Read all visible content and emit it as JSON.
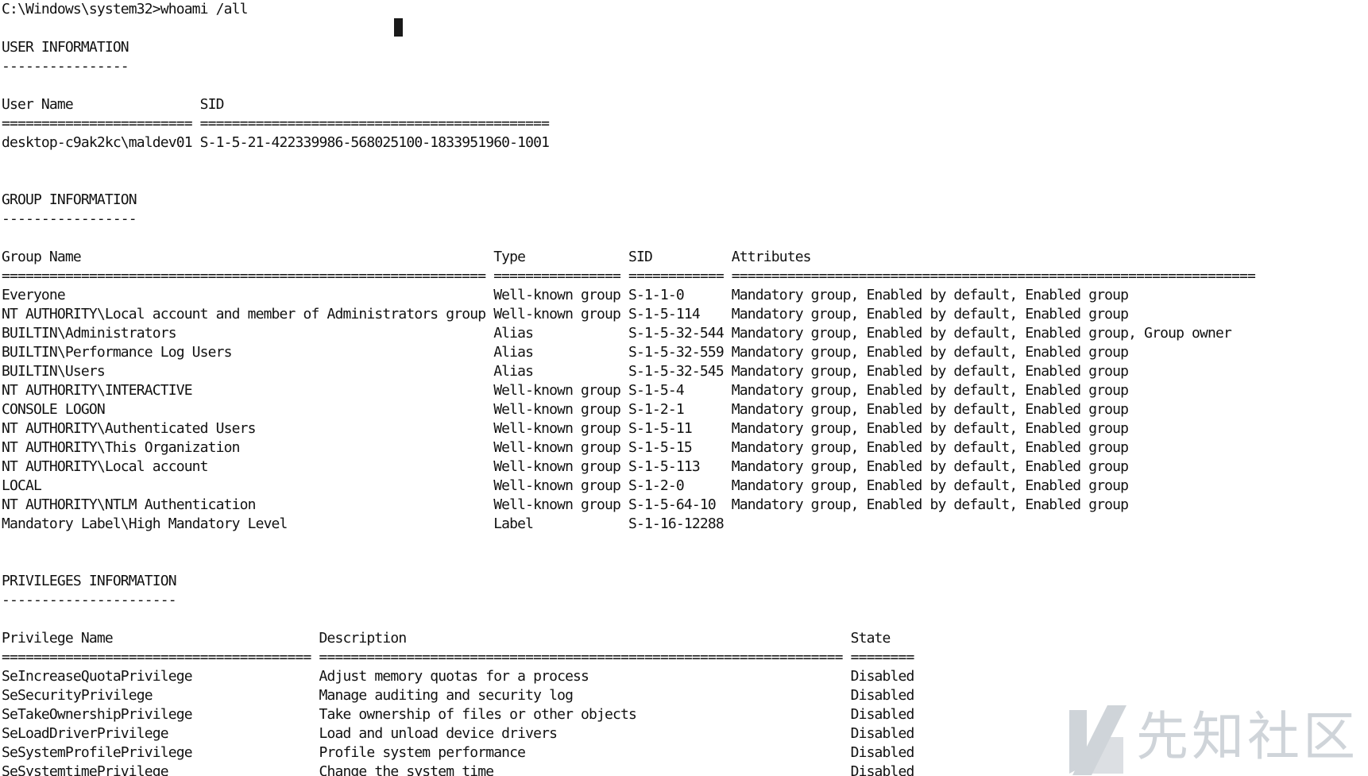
{
  "terminal": {
    "lines": [
      "C:\\Windows\\system32>whoami /all",
      "",
      "USER INFORMATION",
      "----------------",
      "",
      "User Name                SID",
      "======================== ============================================",
      "desktop-c9ak2kc\\maldev01 S-1-5-21-422339986-568025100-1833951960-1001",
      "",
      "",
      "GROUP INFORMATION",
      "-----------------",
      "",
      "Group Name                                                    Type             SID          Attributes",
      "============================================================= ================ ============ ==================================================================",
      "Everyone                                                      Well-known group S-1-1-0      Mandatory group, Enabled by default, Enabled group",
      "NT AUTHORITY\\Local account and member of Administrators group Well-known group S-1-5-114    Mandatory group, Enabled by default, Enabled group",
      "BUILTIN\\Administrators                                        Alias            S-1-5-32-544 Mandatory group, Enabled by default, Enabled group, Group owner",
      "BUILTIN\\Performance Log Users                                 Alias            S-1-5-32-559 Mandatory group, Enabled by default, Enabled group",
      "BUILTIN\\Users                                                 Alias            S-1-5-32-545 Mandatory group, Enabled by default, Enabled group",
      "NT AUTHORITY\\INTERACTIVE                                      Well-known group S-1-5-4      Mandatory group, Enabled by default, Enabled group",
      "CONSOLE LOGON                                                 Well-known group S-1-2-1      Mandatory group, Enabled by default, Enabled group",
      "NT AUTHORITY\\Authenticated Users                              Well-known group S-1-5-11     Mandatory group, Enabled by default, Enabled group",
      "NT AUTHORITY\\This Organization                                Well-known group S-1-5-15     Mandatory group, Enabled by default, Enabled group",
      "NT AUTHORITY\\Local account                                    Well-known group S-1-5-113    Mandatory group, Enabled by default, Enabled group",
      "LOCAL                                                         Well-known group S-1-2-0      Mandatory group, Enabled by default, Enabled group",
      "NT AUTHORITY\\NTLM Authentication                              Well-known group S-1-5-64-10  Mandatory group, Enabled by default, Enabled group",
      "Mandatory Label\\High Mandatory Level                          Label            S-1-16-12288",
      "",
      "",
      "PRIVILEGES INFORMATION",
      "----------------------",
      "",
      "Privilege Name                          Description                                                        State",
      "======================================= ================================================================== ========",
      "SeIncreaseQuotaPrivilege                Adjust memory quotas for a process                                 Disabled",
      "SeSecurityPrivilege                     Manage auditing and security log                                   Disabled",
      "SeTakeOwnershipPrivilege                Take ownership of files or other objects                           Disabled",
      "SeLoadDriverPrivilege                   Load and unload device drivers                                     Disabled",
      "SeSystemProfilePrivilege                Profile system performance                                         Disabled",
      "SeSystemtimePrivilege                   Change the system time                                             Disabled"
    ]
  },
  "watermark": {
    "text": "先知社区"
  },
  "colors": {
    "background": "#ffffff",
    "text": "#111111",
    "watermark": "#8f9aa6"
  }
}
